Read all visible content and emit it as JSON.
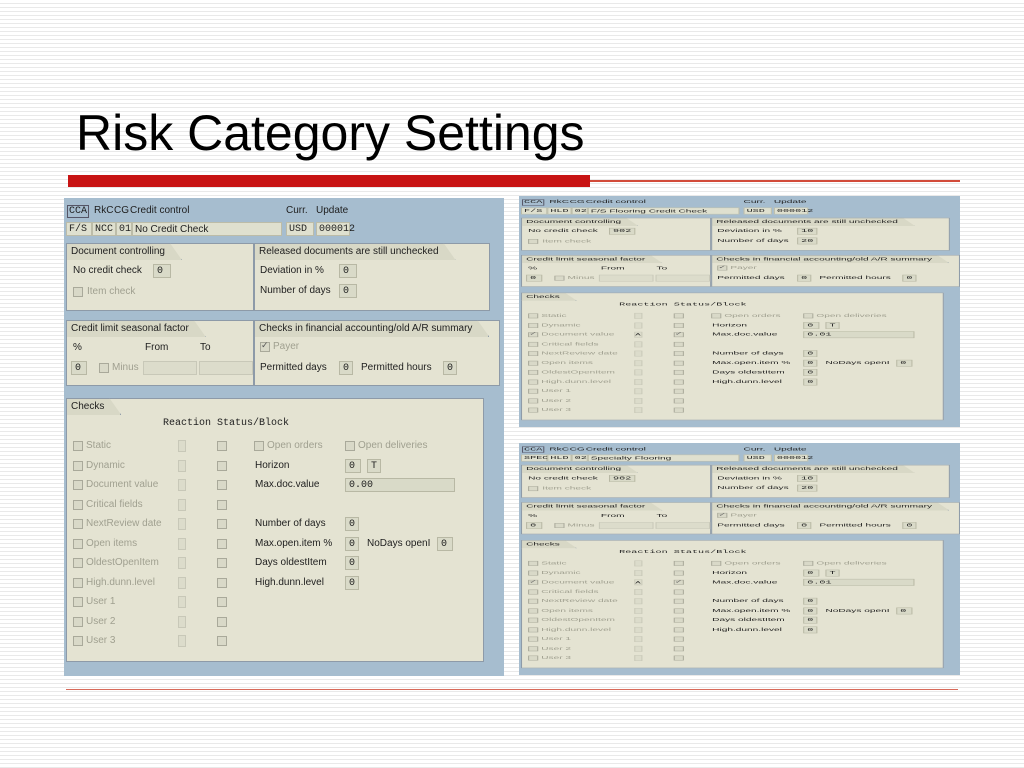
{
  "slide": {
    "title": "Risk Category Settings"
  },
  "screens": [
    {
      "header": {
        "area": "CCA",
        "rkc": "RkC",
        "cg": "CG",
        "label": "Credit control",
        "curr_label": "Curr.",
        "update_label": "Update",
        "area_code": "F/S",
        "risk_cat": "NCC",
        "cg_val": "01",
        "risk_desc": "No Credit Check",
        "currency": "USD",
        "update_val": "000012"
      },
      "doc_ctrl": {
        "title": "Document controlling",
        "check_label": "No credit check",
        "check_val": "0",
        "item_check": "Item check"
      },
      "released": {
        "title": "Released documents are still unchecked",
        "deviation_label": "Deviation in %",
        "deviation_val": "0",
        "days_label": "Number of days",
        "days_val": "0"
      },
      "seasonal": {
        "title": "Credit limit seasonal factor",
        "pct": "%",
        "from": "From",
        "to": "To",
        "pct_val": "0",
        "minus": "Minus"
      },
      "fa_checks": {
        "title": "Checks in financial accounting/old A/R summary",
        "payer": "Payer",
        "permitted_days": "Permitted days",
        "permitted_days_val": "0",
        "permitted_hours": "Permitted hours",
        "permitted_hours_val": "0"
      },
      "checks": {
        "title": "Checks",
        "reaction": "Reaction",
        "status_block": "Status/Block",
        "items": [
          "Static",
          "Dynamic",
          "Document value",
          "Critical fields",
          "NextReview date",
          "Open items",
          "OldestOpenItem",
          "High.dunn.level",
          "User 1",
          "User 2",
          "User 3"
        ],
        "open_orders": "Open orders",
        "open_deliveries": "Open deliveries",
        "horizon": "Horizon",
        "horizon_val": "0",
        "horizon_unit": "T",
        "max_doc": "Max.doc.value",
        "max_doc_val": "0.00",
        "num_days": "Number of days",
        "num_days_val": "0",
        "max_open": "Max.open.item %",
        "max_open_val": "0",
        "nodays": "NoDays openI",
        "nodays_val": "0",
        "days_oldest": "Days oldestItem",
        "days_oldest_val": "0",
        "high_dunn": "High.dunn.level",
        "high_dunn_val": "0"
      }
    },
    {
      "header": {
        "area": "CCA",
        "rkc": "RkC",
        "cg": "CG",
        "label": "Credit control",
        "curr_label": "Curr.",
        "update_label": "Update",
        "area_code": "F/S",
        "risk_cat": "HLD",
        "cg_val": "02",
        "risk_desc": "F/S Flooring Credit Check",
        "currency": "USD",
        "update_val": "000012"
      },
      "doc_ctrl": {
        "title": "Document controlling",
        "check_label": "No credit check",
        "check_val": "902",
        "item_check": "Item check"
      },
      "released": {
        "title": "Released documents are still unchecked",
        "deviation_label": "Deviation in %",
        "deviation_val": "10",
        "days_label": "Number of days",
        "days_val": "20"
      },
      "seasonal": {
        "title": "Credit limit seasonal factor",
        "pct": "%",
        "from": "From",
        "to": "To",
        "pct_val": "0",
        "minus": "Minus"
      },
      "fa_checks": {
        "title": "Checks in financial accounting/old A/R summary",
        "payer": "Payer",
        "permitted_days": "Permitted days",
        "permitted_days_val": "0",
        "permitted_hours": "Permitted hours",
        "permitted_hours_val": "0"
      },
      "checks": {
        "title": "Checks",
        "reaction": "Reaction",
        "status_block": "Status/Block",
        "items": [
          "Static",
          "Dynamic",
          "Document value",
          "Critical fields",
          "NextReview date",
          "Open items",
          "OldestOpenItem",
          "High.dunn.level",
          "User 1",
          "User 2",
          "User 3"
        ],
        "doc_value_reaction": "A",
        "open_orders": "Open orders",
        "open_deliveries": "Open deliveries",
        "horizon": "Horizon",
        "horizon_val": "0",
        "horizon_unit": "T",
        "max_doc": "Max.doc.value",
        "max_doc_val": "0.01",
        "num_days": "Number of days",
        "num_days_val": "0",
        "max_open": "Max.open.item %",
        "max_open_val": "0",
        "nodays": "NoDays openI",
        "nodays_val": "0",
        "days_oldest": "Days oldestItem",
        "days_oldest_val": "0",
        "high_dunn": "High.dunn.level",
        "high_dunn_val": "0"
      }
    },
    {
      "header": {
        "area": "CCA",
        "rkc": "RkC",
        "cg": "CG",
        "label": "Credit control",
        "curr_label": "Curr.",
        "update_label": "Update",
        "area_code": "SPEC",
        "risk_cat": "HLD",
        "cg_val": "02",
        "risk_desc": "Specialty Flooring",
        "currency": "USD",
        "update_val": "000012"
      },
      "doc_ctrl": {
        "title": "Document controlling",
        "check_label": "No credit check",
        "check_val": "902",
        "item_check": "Item check"
      },
      "released": {
        "title": "Released documents are still unchecked",
        "deviation_label": "Deviation in %",
        "deviation_val": "10",
        "days_label": "Number of days",
        "days_val": "20"
      },
      "seasonal": {
        "title": "Credit limit seasonal factor",
        "pct": "%",
        "from": "From",
        "to": "To",
        "pct_val": "0",
        "minus": "Minus"
      },
      "fa_checks": {
        "title": "Checks in financial accounting/old A/R summary",
        "payer": "Payer",
        "permitted_days": "Permitted days",
        "permitted_days_val": "0",
        "permitted_hours": "Permitted hours",
        "permitted_hours_val": "0"
      },
      "checks": {
        "title": "Checks",
        "reaction": "Reaction",
        "status_block": "Status/Block",
        "items": [
          "Static",
          "Dynamic",
          "Document value",
          "Critical fields",
          "NextReview date",
          "Open items",
          "OldestOpenItem",
          "High.dunn.level",
          "User 1",
          "User 2",
          "User 3"
        ],
        "doc_value_reaction": "A",
        "open_orders": "Open orders",
        "open_deliveries": "Open deliveries",
        "horizon": "Horizon",
        "horizon_val": "0",
        "horizon_unit": "T",
        "max_doc": "Max.doc.value",
        "max_doc_val": "0.01",
        "num_days": "Number of days",
        "num_days_val": "0",
        "max_open": "Max.open.item %",
        "max_open_val": "0",
        "nodays": "NoDays openI",
        "nodays_val": "0",
        "days_oldest": "Days oldestItem",
        "days_oldest_val": "0",
        "high_dunn": "High.dunn.level",
        "high_dunn_val": "0"
      }
    }
  ]
}
